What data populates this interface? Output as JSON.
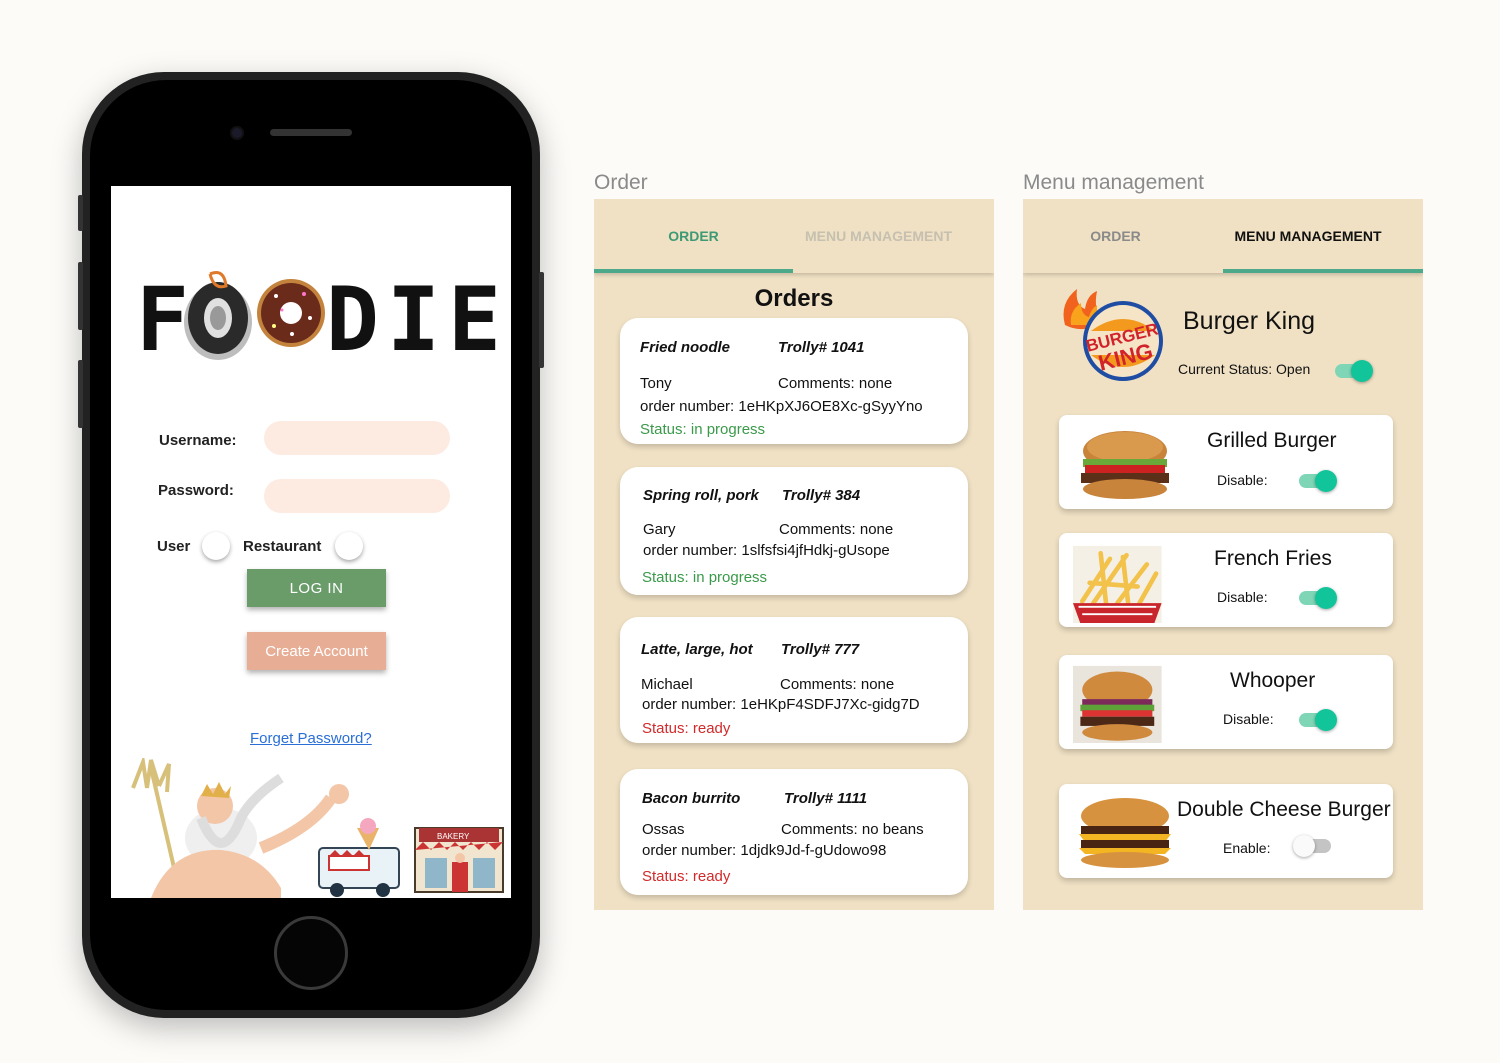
{
  "login": {
    "logo_text": "FOODIE",
    "username_label": "Username:",
    "password_label": "Password:",
    "user_label": "User",
    "restaurant_label": "Restaurant",
    "login_button": "LOG IN",
    "create_button": "Create Account",
    "forget_link": "Forget Password?",
    "illustration_sign": "BAKERY"
  },
  "order_panel": {
    "title": "Order",
    "tabs": [
      {
        "label": "ORDER"
      },
      {
        "label": "MENU MANAGEMENT"
      }
    ],
    "active_tab": "ORDER",
    "heading": "Orders",
    "orders": [
      {
        "item": "Fried noodle",
        "trolly": "Trolly# 1041",
        "name": "Tony",
        "comments": "Comments: none",
        "order_number": "order number: 1eHKpXJ6OE8Xc-gSyyYno",
        "status": "Status: in progress",
        "status_color": "#3a9a4a"
      },
      {
        "item": "Spring roll, pork",
        "trolly": "Trolly# 384",
        "name": "Gary",
        "comments": "Comments: none",
        "order_number": "order number: 1slfsfsi4jfHdkj-gUsope",
        "status": "Status: in progress",
        "status_color": "#3a9a4a"
      },
      {
        "item": "Latte, large, hot",
        "trolly": "Trolly# 777",
        "name": "Michael",
        "comments": "Comments: none",
        "order_number": "order number: 1eHKpF4SDFJ7Xc-gidg7D",
        "status": "Status: ready",
        "status_color": "#d22a2a"
      },
      {
        "item": "Bacon burrito",
        "trolly": "Trolly# 1111",
        "name": "Ossas",
        "comments": "Comments: no beans",
        "order_number": "order number: 1djdk9Jd-f-gUdowo98",
        "status": "Status: ready",
        "status_color": "#d22a2a"
      }
    ]
  },
  "menu_panel": {
    "title": "Menu management",
    "tabs": [
      {
        "label": "ORDER"
      },
      {
        "label": "MENU MANAGEMENT"
      }
    ],
    "active_tab": "MENU MANAGEMENT",
    "restaurant_name": "Burger King",
    "logo_text_1": "BURGER",
    "logo_text_2": "KING",
    "current_status": "Current Status: Open",
    "current_status_on": true,
    "items": [
      {
        "name": "Grilled Burger",
        "toggle_label": "Disable:",
        "on": true
      },
      {
        "name": "French Fries",
        "toggle_label": "Disable:",
        "on": true
      },
      {
        "name": "Whooper",
        "toggle_label": "Disable:",
        "on": true
      },
      {
        "name": "Double Cheese Burger",
        "toggle_label": "Enable:",
        "on": false
      }
    ]
  },
  "colors": {
    "accent": "#4ca98a",
    "panel_bg": "#f0e1c4",
    "login_green": "#6a9c6a",
    "create_peach": "#e8ad95"
  }
}
